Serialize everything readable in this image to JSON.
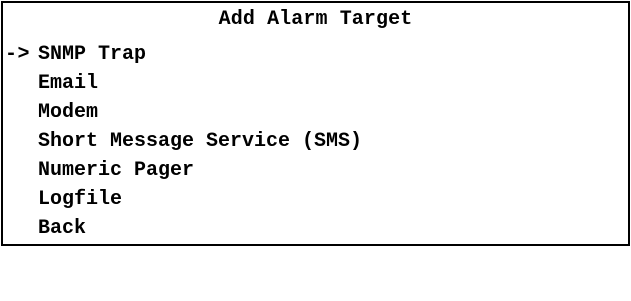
{
  "screen": {
    "title": "Add Alarm Target"
  },
  "menu": {
    "cursor": "->",
    "selected_index": 0,
    "items": [
      {
        "label": "SNMP Trap"
      },
      {
        "label": "Email"
      },
      {
        "label": "Modem"
      },
      {
        "label": "Short Message Service (SMS)"
      },
      {
        "label": "Numeric Pager"
      },
      {
        "label": "Logfile"
      },
      {
        "label": "Back"
      }
    ]
  },
  "colors": {
    "background": "#ffffff",
    "text": "#000000",
    "border": "#000000"
  }
}
